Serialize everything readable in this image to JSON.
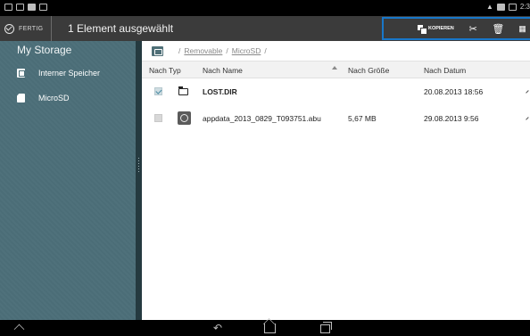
{
  "status_bar": {
    "time": "2:3",
    "left_icons": [
      "wifi-icon",
      "mail-icon",
      "sd-card-icon",
      "image-icon"
    ],
    "right_icons": [
      "signal-icon",
      "notification-icon",
      "battery-icon"
    ]
  },
  "action_bar": {
    "done_label": "FERTIG",
    "selection_text": "1 Element ausgewählt",
    "copy_label": "KOPIEREN",
    "actions": [
      "copy-icon",
      "cut-icon",
      "delete-icon",
      "more-icon"
    ]
  },
  "sidebar": {
    "title": "My Storage",
    "items": [
      {
        "label": "Interner Speicher",
        "icon": "internal-storage-icon"
      },
      {
        "label": "MicroSD",
        "icon": "sd-card-icon"
      }
    ]
  },
  "breadcrumb": {
    "sep": "/",
    "parts": [
      "Removable",
      "MicroSD"
    ],
    "trailing": "/"
  },
  "table": {
    "columns": [
      "Nach Typ",
      "Nach Name",
      "Nach Größe",
      "Nach Datum"
    ],
    "rows": [
      {
        "checked": true,
        "icon": "folder-icon",
        "name": "LOST.DIR",
        "size": "",
        "date": "20.08.2013 18:56"
      },
      {
        "checked": false,
        "icon": "file-icon",
        "name": "appdata_2013_0829_T093751.abu",
        "size": "5,67 MB",
        "date": "29.08.2013 9:56"
      }
    ]
  }
}
